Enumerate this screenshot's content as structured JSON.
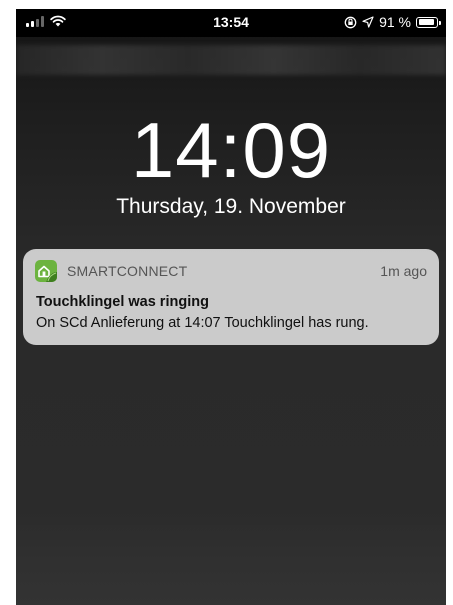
{
  "status_bar": {
    "time": "13:54",
    "battery_percent": "91 %",
    "battery_level": 0.91,
    "icons": [
      "signal-icon",
      "wifi-icon",
      "orientation-lock-icon",
      "location-icon",
      "battery-icon"
    ]
  },
  "lock_screen": {
    "time": "14:09",
    "date": "Thursday, 19. November"
  },
  "notification": {
    "app_name": "SMARTCONNECT",
    "age": "1m ago",
    "title": "Touchklingel was ringing",
    "body": "On SCd Anlieferung at 14:07 Touchklingel has rung.",
    "icon": "smartconnect-app-icon",
    "icon_color": "#6cb33f"
  }
}
